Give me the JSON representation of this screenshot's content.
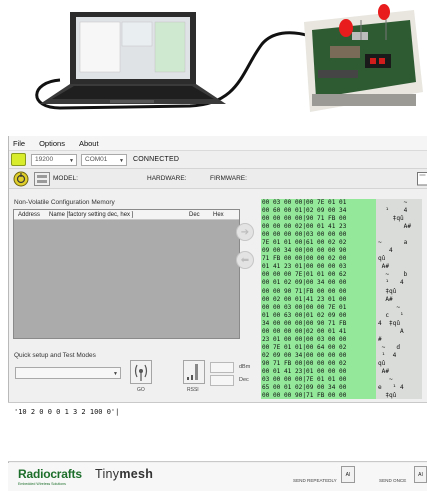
{
  "menu": [
    "File",
    "Options",
    "About"
  ],
  "toolbar": {
    "baud": "19200",
    "port": "COM01",
    "status": "CONNECTED"
  },
  "device_bar": {
    "model_label": "MODEL:",
    "hardware_label": "HARDWARE:",
    "firmware_label": "FIRMWARE:"
  },
  "memory": {
    "title": "Non-Volatile Configuration Memory",
    "columns": [
      "Address",
      "Name  [factory setting dec, hex ]",
      "Dec",
      "Hex"
    ]
  },
  "quick": {
    "title": "Quick setup and Test Modes",
    "go_label": "GO",
    "rssi_label": "RSSI",
    "dbm_label": "dBm",
    "dec_label": "Dec"
  },
  "hex_rows": [
    "00 03 00 00|00 7E 01 01",
    "00 60 00 01|02 09 00 34",
    "00 00 00 00|90 71 FB 00",
    "00 00 00 02|00 01 41 23",
    "00 00 00 00|03 00 00 00",
    "7E 01 01 00|61 00 02 02",
    "09 00 34 00|00 00 00 90",
    "71 FB 00 00|00 00 02 00",
    "01 41 23 01|00 00 00 03",
    "00 00 00 7E|01 01 00 62",
    "00 01 02 09|00 34 00 00",
    "00 00 90 71|FB 00 00 00",
    "00 02 00 01|41 23 01 00",
    "00 00 03 00|00 00 7E 01",
    "01 00 63 00|01 02 09 00",
    "34 00 00 00|00 90 71 FB",
    "00 00 00 00|02 00 01 41",
    "23 01 00 00|00 03 00 00",
    "00 7E 01 01|00 64 00 02",
    "02 09 00 34|00 00 00 00",
    "90 71 FB 00|00 00 00 02",
    "00 01 41 23|01 00 00 00",
    "03 00 00 00|7E 01 01 00",
    "65 00 01 02|09 00 34 00",
    "00 00 00 90|71 FB 00 00",
    "00 00 02 00|01 41 __ __"
  ],
  "hex_ascii": [
    "       ~ ",
    "  ¹    4",
    "    ‡qû",
    "       A#",
    "",
    "~      a",
    "   4  ",
    "qû      ",
    " A#    ",
    "  ~    b",
    "  ¹   4",
    "  ‡qû  ",
    "  A#   ",
    "     ~ ",
    "  c   ¹",
    "4  ‡qû",
    "      A",
    "#      ",
    " ~   d",
    " ¹  4",
    "qû    ",
    " A#   ",
    "   ~   ",
    "e   ¹ 4",
    "  ‡qû  ",
    "    A"
  ],
  "command": "'10 2 0 0 0 1 3 2 100 0'|",
  "footer": {
    "brand": "Radiocrafts",
    "brand_sub": "Embedded Wireless Solutions",
    "product_light": "Tiny",
    "product_bold": "mesh",
    "send_repeatedly": "SEND REPEATEDLY",
    "send_once": "SEND ONCE",
    "btn_label": "AI"
  },
  "colors": {
    "connect_led": "#d8ec2c",
    "hex_bg": "#93e89a",
    "brand_green": "#1d6e2b"
  },
  "icons": [
    "laptop-icon",
    "device-board-icon",
    "connect-led-icon",
    "refresh-icon",
    "module-icon",
    "copy-icon",
    "arrow-right-icon",
    "arrow-left-icon",
    "antenna-icon",
    "rssi-meter-icon"
  ]
}
